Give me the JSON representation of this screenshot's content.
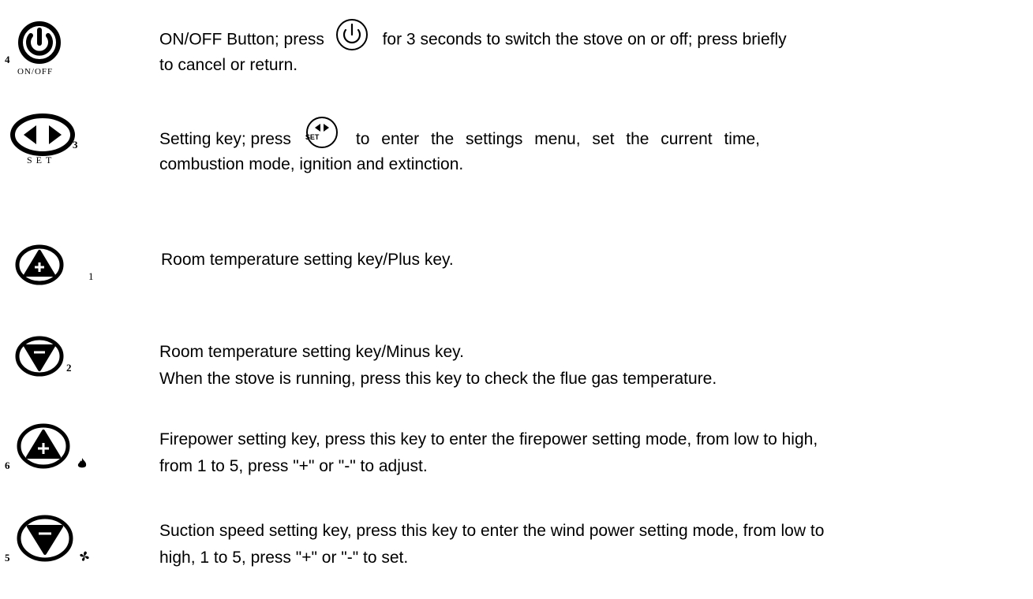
{
  "items": [
    {
      "number": "4",
      "caption": "ON/OFF",
      "text_before": "ON/OFF Button; press",
      "text_after": "for 3 seconds to switch the stove on or off; press briefly",
      "line2": "to cancel or return."
    },
    {
      "number": "3",
      "caption": "SET",
      "inline_caption": "SET",
      "text_before": "Setting key; press",
      "text_after": "to enter the settings menu, set the current time,",
      "line2": "combustion mode, ignition and extinction."
    },
    {
      "number": "1",
      "line1": "Room temperature setting key/Plus key."
    },
    {
      "number": "2",
      "line1": "Room temperature setting key/Minus key.",
      "line2": "When the stove is running, press this key to check the flue gas temperature."
    },
    {
      "number": "6",
      "line1": "Firepower setting key, press this key to enter the firepower setting mode, from low to high,",
      "line2": "from 1 to 5, press \"+\" or \"-\" to adjust."
    },
    {
      "number": "5",
      "line1": "Suction speed setting key, press this key to enter the wind power setting mode, from low to",
      "line2": "high, 1 to 5, press \"+\" or \"-\" to set."
    }
  ],
  "icons": [
    "power-icon",
    "arrows-set-icon",
    "plus-icon",
    "minus-icon",
    "flame-icon",
    "fan-icon"
  ]
}
